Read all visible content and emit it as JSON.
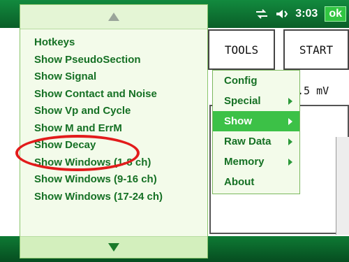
{
  "status": {
    "time": "3:03",
    "ok": "ok"
  },
  "background": {
    "tools_label": "TOOLS",
    "start_label": "START",
    "value_text": ".5 mV"
  },
  "menu": {
    "items": [
      "Hotkeys",
      "Show PseudoSection",
      "Show Signal",
      "Show Contact and Noise",
      "Show Vp and Cycle",
      "Show M and ErrM",
      "Show Decay",
      "Show Windows (1-8 ch)",
      "Show Windows (9-16 ch)",
      "Show Windows (17-24 ch)"
    ]
  },
  "submenu": {
    "items": [
      {
        "label": "Config",
        "has_submenu": false,
        "selected": false
      },
      {
        "label": "Special",
        "has_submenu": true,
        "selected": false
      },
      {
        "label": "Show",
        "has_submenu": true,
        "selected": true
      },
      {
        "label": "Raw Data",
        "has_submenu": true,
        "selected": false
      },
      {
        "label": "Memory",
        "has_submenu": true,
        "selected": false
      },
      {
        "label": "About",
        "has_submenu": false,
        "selected": false
      }
    ]
  },
  "colors": {
    "accent": "#157024",
    "selected": "#3cc147",
    "highlight": "#e21b1b"
  }
}
